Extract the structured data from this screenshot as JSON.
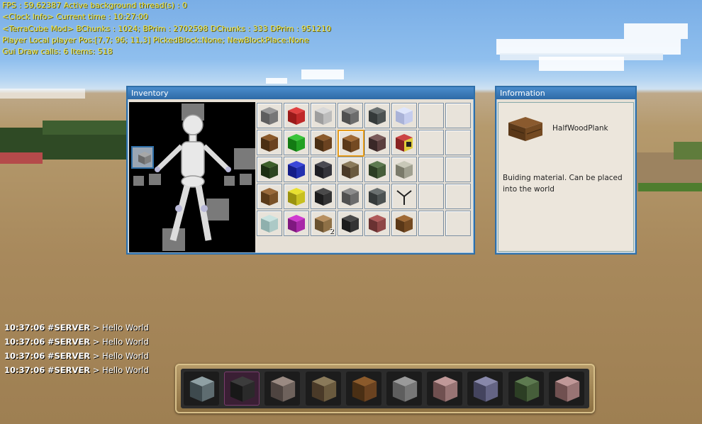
{
  "debug": {
    "line1": "FPS : 59,62387 Active background thread(s) : 0",
    "line2": "<Clock Info> Current time : 10:27:00",
    "line3": "<TerraCube Mod> BChunks : 1024; BPrim : 2702598 DChunks : 333 DPrim : 951210",
    "line4": "Player Local player Pos:[7,7; 96; 11,3] PickedBlock:None; NewBlockPlace:None",
    "line5": "Gui Draw calls: 6 Items: 518"
  },
  "inventory": {
    "title": "Inventory",
    "equipped_item": "stone-cube-icon",
    "slots": [
      [
        "stone",
        "red",
        "lightstone",
        "ore",
        "darkore",
        "glass",
        "",
        ""
      ],
      [
        "wood",
        "green",
        "wood",
        "halfplank",
        "redore",
        "tnt",
        "",
        ""
      ],
      [
        "mossy",
        "blue",
        "obsidian",
        "goldore",
        "mossystone",
        "gravel",
        "",
        ""
      ],
      [
        "plank",
        "yellow",
        "coal",
        "ore",
        "darkore",
        "tool",
        "",
        ""
      ],
      [
        "ice",
        "magenta",
        "sand",
        "coal",
        "brick",
        "halfplank",
        "",
        ""
      ]
    ],
    "counts": {
      "4-2": "2"
    },
    "selected_slot": "1-3"
  },
  "information": {
    "title": "Information",
    "item_name": "HalfWoodPlank",
    "description": "Buiding material. Can be placed into the world"
  },
  "chat": [
    {
      "time": "10:37:06",
      "sender": "#SERVER",
      "arrow": ">",
      "message": "Hello World"
    },
    {
      "time": "10:37:06",
      "sender": "#SERVER",
      "arrow": ">",
      "message": "Hello World"
    },
    {
      "time": "10:37:06",
      "sender": "#SERVER",
      "arrow": ">",
      "message": "Hello World"
    },
    {
      "time": "10:37:06",
      "sender": "#SERVER",
      "arrow": ">",
      "message": "Hello World"
    }
  ],
  "hotbar": {
    "items": [
      "diamondore",
      "coalore",
      "ironore",
      "goldore",
      "wood",
      "stone",
      "pinkstone",
      "bluestone",
      "mossystone",
      "pinkstone"
    ],
    "active_index": 1
  },
  "colors": {
    "window_border": "#2f6fa8",
    "debug_text": "#f4e94a",
    "selection": "#e59c1b"
  }
}
